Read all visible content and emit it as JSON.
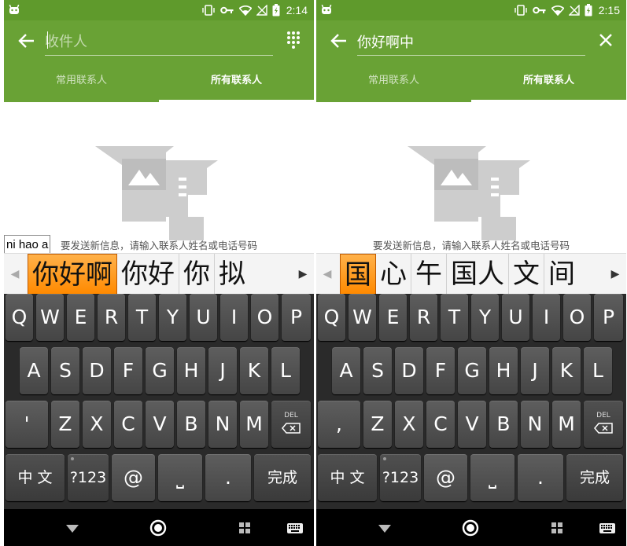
{
  "screens": [
    {
      "statusbar": {
        "time": "2:14"
      },
      "search": {
        "value": "",
        "placeholder": "收件人"
      },
      "trailing_icon": "dialpad-icon",
      "tabs": [
        {
          "label": "常用联系人"
        },
        {
          "label": "所有联系人"
        }
      ],
      "active_tab": 1,
      "empty_text": "要发送新信息，请输入联系人姓名或电话号码",
      "composing": "ni hao a",
      "candidates": [
        "你好啊",
        "你好",
        "你",
        "拟"
      ],
      "keyboard": {
        "row1": [
          "Q",
          "W",
          "E",
          "R",
          "T",
          "Y",
          "U",
          "I",
          "O",
          "P"
        ],
        "row2": [
          "A",
          "S",
          "D",
          "F",
          "G",
          "H",
          "J",
          "K",
          "L"
        ],
        "row3": [
          "'",
          "Z",
          "X",
          "C",
          "V",
          "B",
          "N",
          "M"
        ],
        "del_label": "DEL",
        "lang": "中 文",
        "sym": "?123",
        "at": "@",
        "space": "⎵",
        "period": ".",
        "done": "完成"
      }
    },
    {
      "statusbar": {
        "time": "2:15"
      },
      "search": {
        "value": "你好啊中",
        "placeholder": ""
      },
      "trailing_icon": "close-icon",
      "tabs": [
        {
          "label": "常用联系人"
        },
        {
          "label": "所有联系人"
        }
      ],
      "active_tab": 1,
      "empty_text": "要发送新信息，请输入联系人姓名或电话号码",
      "composing": "",
      "candidates": [
        "国",
        "心",
        "午",
        "国人",
        "文",
        "间"
      ],
      "keyboard": {
        "row1": [
          "Q",
          "W",
          "E",
          "R",
          "T",
          "Y",
          "U",
          "I",
          "O",
          "P"
        ],
        "row2": [
          "A",
          "S",
          "D",
          "F",
          "G",
          "H",
          "J",
          "K",
          "L"
        ],
        "row3": [
          ",",
          "Z",
          "X",
          "C",
          "V",
          "B",
          "N",
          "M"
        ],
        "del_label": "DEL",
        "lang": "中 文",
        "sym": "?123",
        "at": "@",
        "space": "⎵",
        "period": ".",
        "done": "完成"
      }
    }
  ],
  "colors": {
    "statusbar": "#5f9a2c",
    "appbar": "#69a235",
    "candidate_highlight": "#ff9a1f",
    "keyboard_bg": "#2a2a2a"
  }
}
